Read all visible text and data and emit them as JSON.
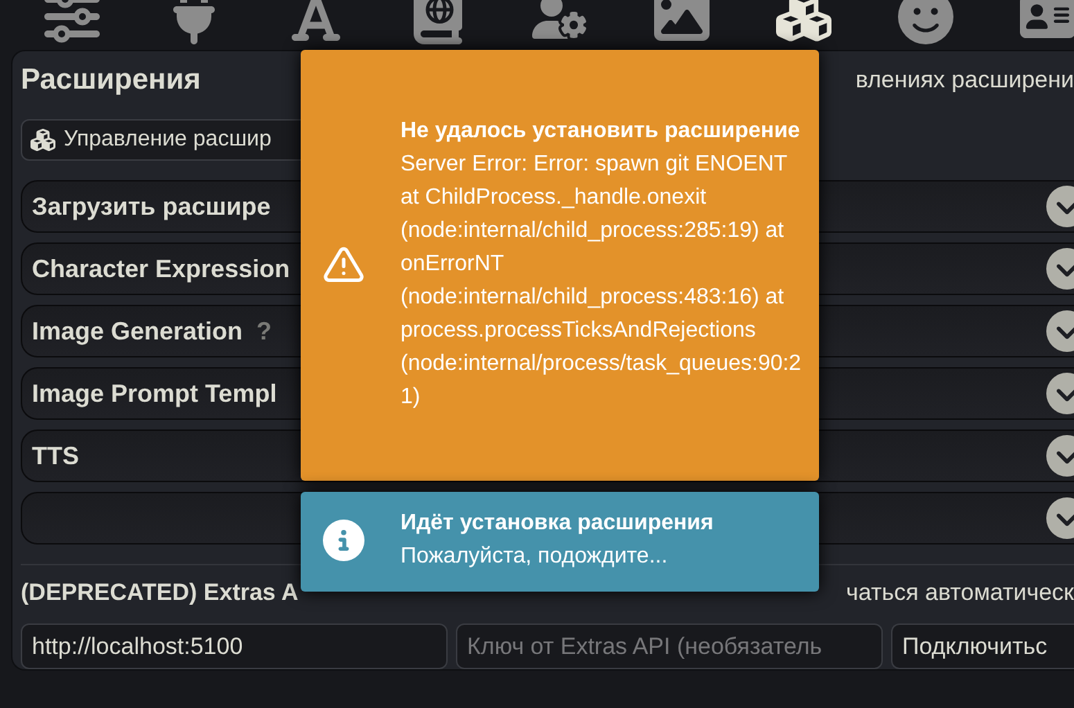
{
  "nav_tabs": [
    {
      "kind": "sliders",
      "selected": false
    },
    {
      "kind": "plug",
      "selected": false
    },
    {
      "kind": "font",
      "selected": false
    },
    {
      "kind": "book",
      "selected": false
    },
    {
      "kind": "user-gear",
      "selected": false
    },
    {
      "kind": "image",
      "selected": false
    },
    {
      "kind": "cubes",
      "selected": true
    },
    {
      "kind": "smile",
      "selected": false
    },
    {
      "kind": "card",
      "selected": false
    }
  ],
  "panel": {
    "title": "Расширения",
    "header_right": "влениях расширени",
    "manage_button": "Управление расшир",
    "sections": [
      {
        "title": "Загрузить расшире",
        "expanded": false
      },
      {
        "title": "Character Expression",
        "expanded": false
      },
      {
        "title": "Image Generation",
        "help": "?",
        "expanded": false
      },
      {
        "title": "Image Prompt Templ",
        "expanded": false
      },
      {
        "title": "TTS",
        "expanded": false
      },
      {
        "expanded": false
      }
    ],
    "extras": {
      "heading": "(DEPRECATED) Extras A",
      "heading_right": "чаться автоматическ",
      "url_value": "http://localhost:5100",
      "key_placeholder": "Ключ от Extras API (необязатель",
      "connect_button": "Подключитьс"
    }
  },
  "toasts": [
    {
      "kind": "error",
      "title": "Не удалось установить расширение",
      "message": "Server Error: Error: spawn git ENOENT at ChildProcess._handle.onexit (node:internal/child_process:285:19) at onErrorNT (node:internal/child_process:483:16) at process.processTicksAndRejections (node:internal/process/task_queues:90:21)"
    },
    {
      "kind": "info",
      "title": "Идёт установка расширения",
      "message": "Пожалуйста, подождите..."
    }
  ]
}
